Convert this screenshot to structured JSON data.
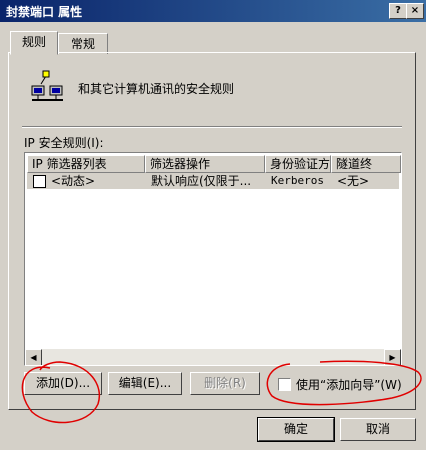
{
  "window": {
    "title": "封禁端口 属性",
    "help_button": "?",
    "close_button": "×"
  },
  "tabs": [
    {
      "label": "规则"
    },
    {
      "label": "常规"
    }
  ],
  "panel": {
    "description": "和其它计算机通讯的安全规则",
    "list_label": "IP 安全规则(I):",
    "columns": [
      "IP 筛选器列表",
      "筛选器操作",
      "身份验证方法",
      "隧道终"
    ],
    "rows": [
      {
        "checked": false,
        "filter_list": "<动态>",
        "filter_action": "默认响应(仅限于...",
        "auth": "Kerberos",
        "tunnel": "<无>"
      }
    ]
  },
  "buttons": {
    "add": "添加(D)...",
    "edit": "编辑(E)...",
    "remove": "删除(R)",
    "wizard_checkbox": "使用“添加向导”(W)",
    "ok": "确定",
    "cancel": "取消"
  }
}
